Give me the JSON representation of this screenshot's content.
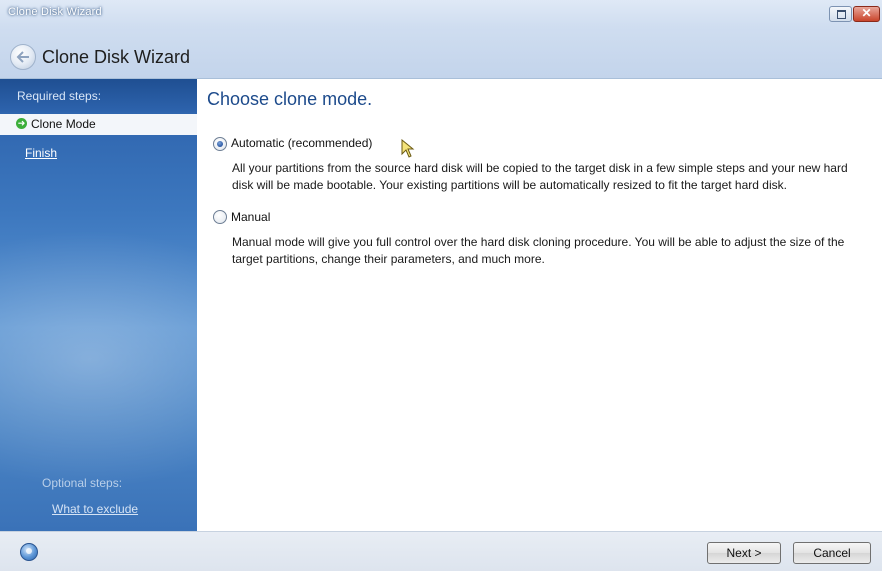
{
  "window": {
    "title_small": "Clone Disk Wizard",
    "title_large": "Clone Disk Wizard"
  },
  "sidebar": {
    "required_header": "Required steps:",
    "items": [
      {
        "label": "Clone Mode",
        "active": true
      },
      {
        "label": "Finish",
        "active": false
      }
    ],
    "optional_header": "Optional steps:",
    "optional_items": [
      {
        "label": "What to exclude"
      }
    ]
  },
  "main": {
    "heading": "Choose clone mode.",
    "options": [
      {
        "label": "Automatic (recommended)",
        "selected": true,
        "description": "All your partitions from the source hard disk will be copied to the target disk in a few simple steps and your new hard disk will be made bootable. Your existing partitions will be automatically resized to fit the target hard disk."
      },
      {
        "label": "Manual",
        "selected": false,
        "description": "Manual mode will give you full control over the hard disk cloning procedure. You will be able to adjust the size of the target partitions, change their parameters, and much more."
      }
    ]
  },
  "footer": {
    "next_label": "Next >",
    "cancel_label": "Cancel"
  },
  "colors": {
    "accent": "#1c4a8b",
    "sidebar": "#3d78bf"
  }
}
